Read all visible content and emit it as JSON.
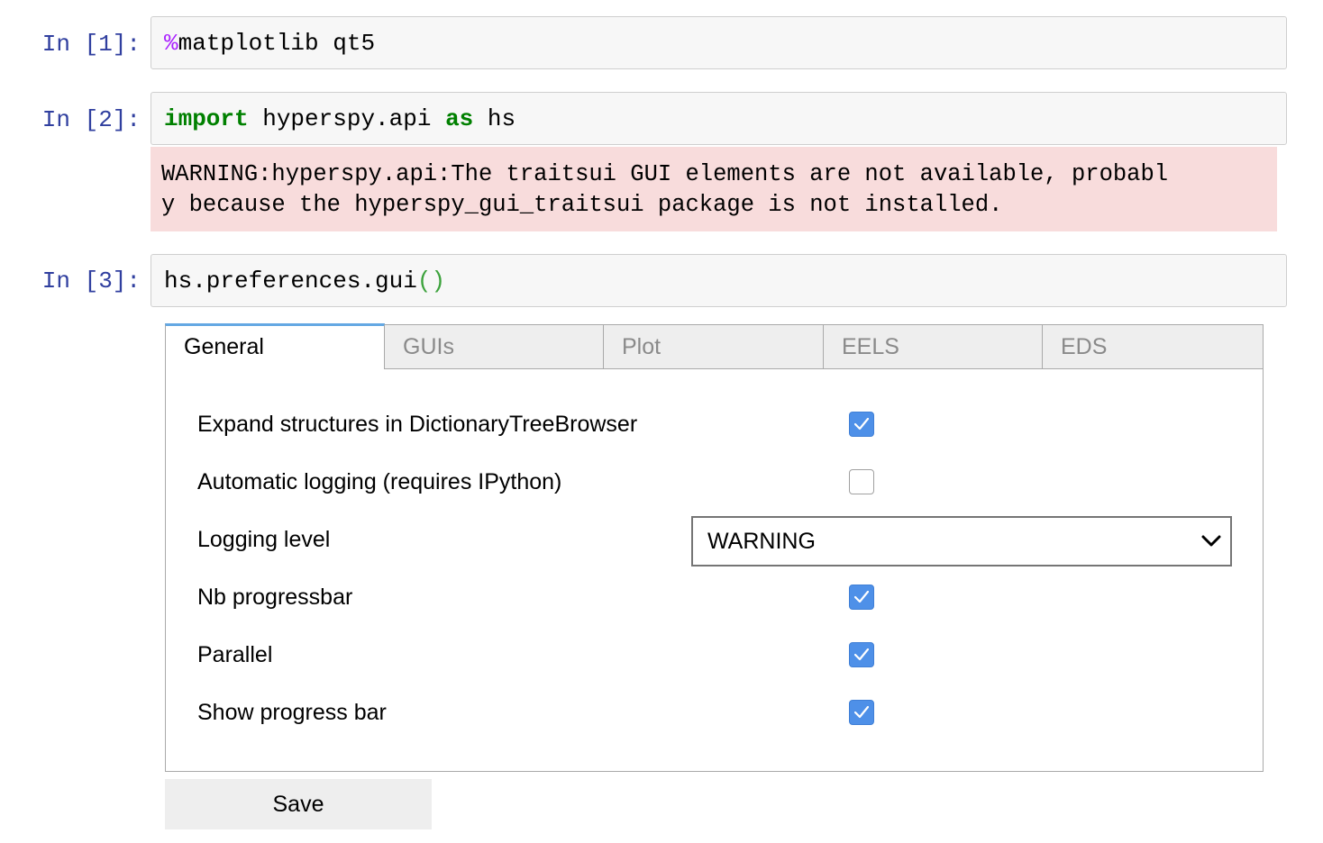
{
  "cells": [
    {
      "prompt": "In [1]:",
      "code": {
        "magic": "%",
        "text": "matplotlib qt5"
      }
    },
    {
      "prompt": "In [2]:",
      "code": {
        "kw1": "import",
        "mod": " hyperspy.api ",
        "kw2": "as",
        "alias": " hs"
      }
    },
    {
      "prompt": "In [3]:",
      "code": {
        "text": "hs.preferences.gui",
        "paren": "()"
      }
    }
  ],
  "stderr": {
    "line1": "WARNING:hyperspy.api:The traitsui GUI elements are not available, probabl",
    "line2": "y because the hyperspy_gui_traitsui package is not installed."
  },
  "tabs": [
    {
      "label": "General",
      "active": true
    },
    {
      "label": "GUIs",
      "active": false
    },
    {
      "label": "Plot",
      "active": false
    },
    {
      "label": "EELS",
      "active": false
    },
    {
      "label": "EDS",
      "active": false
    }
  ],
  "general": {
    "expand_structures": {
      "label": "Expand structures in DictionaryTreeBrowser",
      "checked": true
    },
    "automatic_logging": {
      "label": "Automatic logging (requires IPython)",
      "checked": false
    },
    "logging_level": {
      "label": "Logging level",
      "value": "WARNING"
    },
    "nb_progressbar": {
      "label": "Nb progressbar",
      "checked": true
    },
    "parallel": {
      "label": "Parallel",
      "checked": true
    },
    "show_progress_bar": {
      "label": "Show progress bar",
      "checked": true
    }
  },
  "save_label": "Save",
  "colors": {
    "accent": "#64a8e3",
    "checkbox": "#4e90e8",
    "stderr_bg": "#f8dcdc",
    "prompt": "#303f9f"
  }
}
